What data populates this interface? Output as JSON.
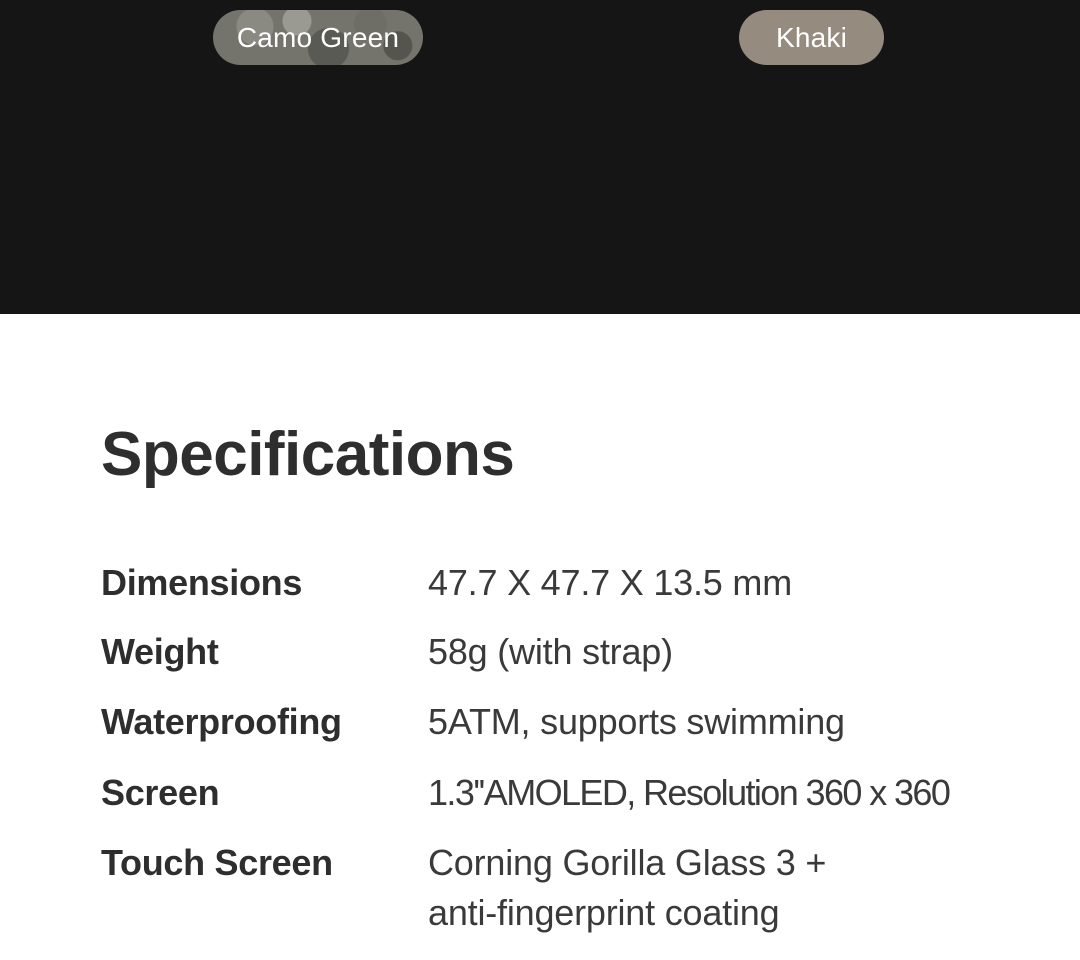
{
  "color_options": [
    {
      "label": "Camo Green",
      "color": "#74746c"
    },
    {
      "label": "Khaki",
      "color": "#958b7e"
    }
  ],
  "specifications": {
    "title": "Specifications",
    "rows": [
      {
        "label": "Dimensions",
        "value": "47.7  X 47.7 X 13.5 mm"
      },
      {
        "label": "Weight",
        "value": "58g (with strap)"
      },
      {
        "label": "Waterproofing",
        "value": "5ATM, supports swimming"
      },
      {
        "label": "Screen",
        "value": "1.3''AMOLED, Resolution 360 x 360"
      },
      {
        "label": "Touch Screen",
        "value": "Corning Gorilla Glass 3 + anti-fingerprint coating"
      }
    ]
  }
}
